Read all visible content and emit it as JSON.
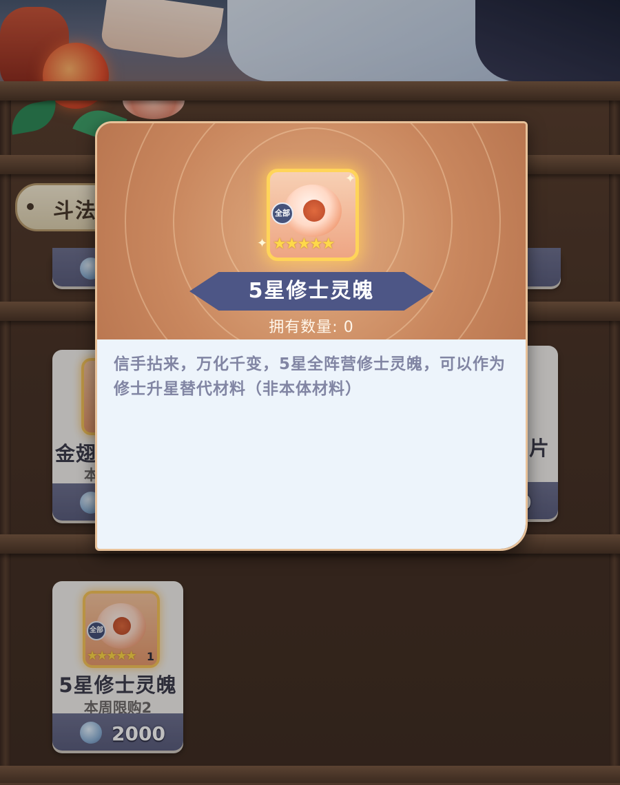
{
  "shop": {
    "tab_label": "斗法仙",
    "cards": [
      {
        "name": "金翅",
        "limit": "本",
        "price": ""
      },
      {
        "name": "片",
        "limit": "",
        "price": "0"
      },
      {
        "name": "5星修士灵魄",
        "limit": "本周限购2",
        "price": "2000",
        "badge": "全部",
        "count": "1",
        "stars": "★★★★★"
      }
    ]
  },
  "popup": {
    "title": "5星修士灵魄",
    "owned_label": "拥有数量:",
    "owned_value": "0",
    "badge": "全部",
    "stars": "★★★★★",
    "description": "信手拈来，万化千变，5星全阵营修士灵魄，可以作为修士升星替代材料（非本体材料）"
  },
  "colors": {
    "accent_banner": "#4d5686",
    "price_bar": "#5b5e7e",
    "desc_text": "#8185a3",
    "star": "#ffd94a"
  }
}
